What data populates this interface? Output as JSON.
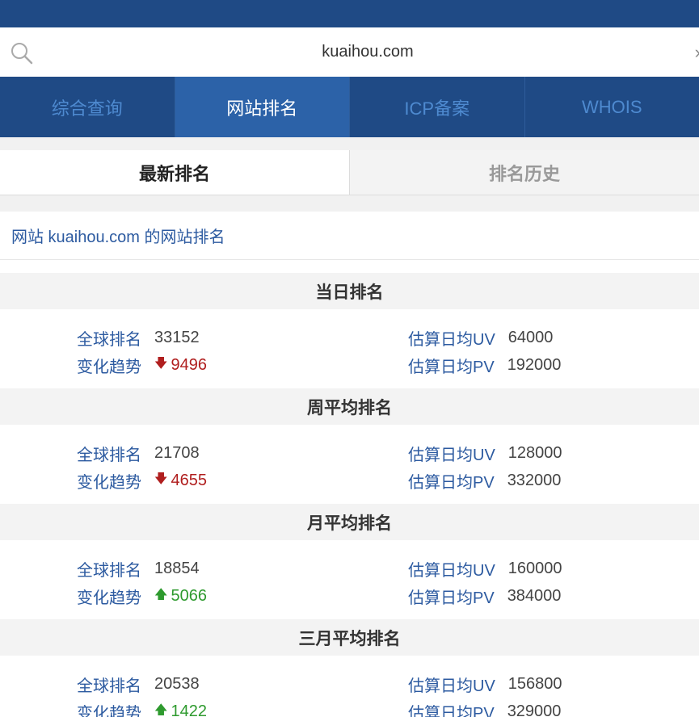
{
  "search": {
    "value": "kuaihou.com",
    "edge_glyph": "›"
  },
  "nav": {
    "tabs": [
      {
        "label": "综合查询",
        "active": false
      },
      {
        "label": "网站排名",
        "active": true
      },
      {
        "label": "ICP备案",
        "active": false
      },
      {
        "label": "WHOIS",
        "active": false
      }
    ]
  },
  "subtabs": [
    {
      "label": "最新排名",
      "active": true
    },
    {
      "label": "排名历史",
      "active": false
    }
  ],
  "site_line": "网站 kuaihou.com 的网站排名",
  "labels": {
    "global_rank": "全球排名",
    "trend": "变化趋势",
    "uv": "估算日均UV",
    "pv": "估算日均PV"
  },
  "sections": [
    {
      "title": "当日排名",
      "global_rank": "33152",
      "trend_dir": "down",
      "trend_value": "9496",
      "uv": "64000",
      "pv": "192000"
    },
    {
      "title": "周平均排名",
      "global_rank": "21708",
      "trend_dir": "down",
      "trend_value": "4655",
      "uv": "128000",
      "pv": "332000"
    },
    {
      "title": "月平均排名",
      "global_rank": "18854",
      "trend_dir": "up",
      "trend_value": "5066",
      "uv": "160000",
      "pv": "384000"
    },
    {
      "title": "三月平均排名",
      "global_rank": "20538",
      "trend_dir": "up",
      "trend_value": "1422",
      "uv": "156800",
      "pv": "329000"
    }
  ],
  "colors": {
    "header_bg": "#1f4a85",
    "active_tab_bg": "#2c62a8",
    "label_blue": "#2c5aa0",
    "trend_down": "#b01e1e",
    "trend_up": "#2e9a2e"
  },
  "icons": {
    "search": "search-icon",
    "arrow_down": "arrow-down-icon",
    "arrow_up": "arrow-up-icon"
  }
}
